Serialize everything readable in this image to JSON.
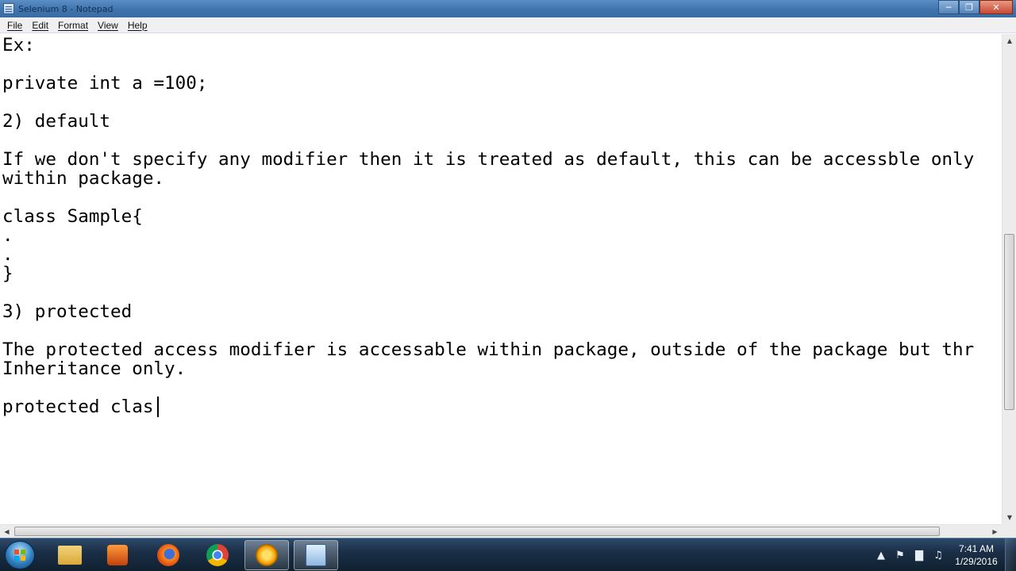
{
  "window": {
    "title": "Selenium 8 - Notepad",
    "minimize_glyph": "─",
    "restore_glyph": "❐",
    "close_glyph": "✕"
  },
  "menu": {
    "file": "File",
    "edit": "Edit",
    "format": "Format",
    "view": "View",
    "help": "Help"
  },
  "editor": {
    "lines": [
      "Ex:",
      "",
      "private int a =100;",
      "",
      "2) default",
      "",
      "If we don't specify any modifier then it is treated as default, this can be accessble only",
      "within package.",
      "",
      "class Sample{",
      ".",
      ".",
      "}",
      "",
      "3) protected",
      "",
      "The protected access modifier is accessable within package, outside of the package but thr",
      "Inheritance only.",
      "",
      "protected clas"
    ]
  },
  "scrollbars": {
    "up_glyph": "▲",
    "down_glyph": "▼",
    "left_glyph": "◀",
    "right_glyph": "▶"
  },
  "taskbar": {
    "apps": [
      {
        "name": "windows-explorer",
        "icon": "folder-icon"
      },
      {
        "name": "media-player",
        "icon": "media-player-icon"
      },
      {
        "name": "firefox",
        "icon": "firefox-icon"
      },
      {
        "name": "chrome",
        "icon": "chrome-icon"
      },
      {
        "name": "app",
        "icon": "app-icon"
      },
      {
        "name": "notepad",
        "icon": "notepad-icon"
      }
    ],
    "tray": {
      "show_hidden_glyph": "▲",
      "flag_glyph": "⚑",
      "network_glyph": "▇",
      "volume_glyph": "♫"
    },
    "clock": {
      "time": "7:41 AM",
      "date": "1/29/2016"
    }
  }
}
